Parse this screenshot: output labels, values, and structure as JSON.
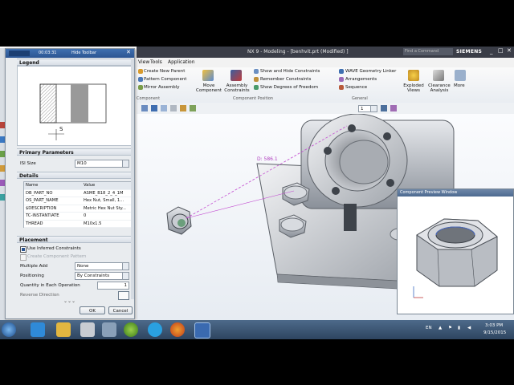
{
  "window": {
    "title": "NX 9 - Modeling - [benhvit.prt (Modified) ]",
    "find_placeholder": "Find a Command",
    "brand": "SIEMENS"
  },
  "small_toolbar": {
    "field_value": "00:03:31",
    "hide_label": "Hide Toolbar"
  },
  "menu": {
    "items": [
      "View",
      "Tools",
      "Application"
    ]
  },
  "ribbon": {
    "assemblies_list": [
      "Create New Parent",
      "Pattern Component",
      "Mirror Assembly"
    ],
    "move_component": "Move Component",
    "assembly_constraints": "Assembly Constraints",
    "position_list": [
      "Show and Hide Constraints",
      "Remember Constraints",
      "Show Degrees of Freedom"
    ],
    "general_list": [
      "WAVE Geometry Linker",
      "Arrangements",
      "Sequence"
    ],
    "exploded_views": "Exploded Views",
    "clearance_analysis": "Clearance Analysis",
    "more": "More",
    "groups": [
      "Component",
      "Component Position",
      "General"
    ]
  },
  "dialog": {
    "legend_title": "Legend",
    "legend_dim": "S",
    "primary_title": "Primary Parameters",
    "iso_size_label": "ISI Size",
    "iso_size_value": "M10",
    "details_title": "Details",
    "details_headers": [
      "Name",
      "Value"
    ],
    "details_rows": [
      [
        "DB_PART_NO",
        "ASME_B18_2_4_1M"
      ],
      [
        "OS_PART_NAME",
        "Hex Nut, Small, 1..."
      ],
      [
        "$DESCRIPTION",
        "Metric Hex Nut Sty..."
      ],
      [
        "TC-INSTANTIATE",
        "0"
      ],
      [
        "THREAD",
        "M10x1.5"
      ]
    ],
    "placement_title": "Placement",
    "use_inferred": "Use Inferred Constraints",
    "create_pattern": "Create Component Pattern",
    "multiple_add_label": "Multiple Add",
    "multiple_add_value": "None",
    "positioning_label": "Positioning",
    "positioning_value": "By Constraints",
    "quantity_label": "Quantity in Each Operation",
    "quantity_value": "1",
    "reverse_label": "Reverse Direction",
    "ok": "OK",
    "cancel": "Cancel"
  },
  "selection_bar": {
    "filter_value": "1"
  },
  "viewport": {
    "distance_label": "D: 586.1"
  },
  "preview": {
    "title": "Component Preview Window"
  },
  "taskbar": {
    "language": "EN",
    "time": "3:03 PM",
    "date": "9/15/2015"
  },
  "colors": {
    "accent": "#2b5592",
    "taskbar": "#2e4560",
    "viewport": "#e7ecf2"
  }
}
